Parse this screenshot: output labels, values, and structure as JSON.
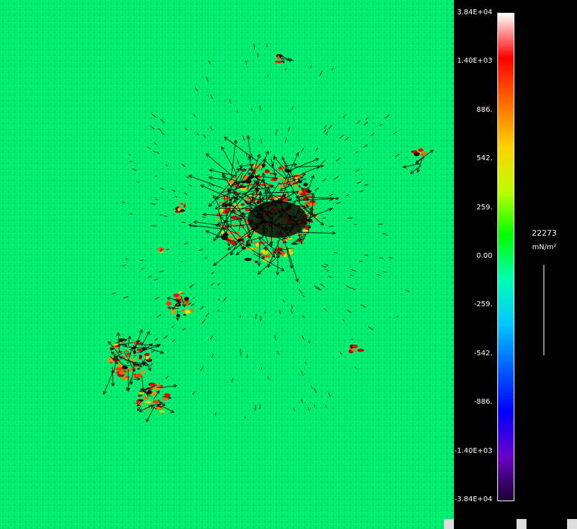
{
  "colorbar": {
    "ticks": [
      "3.84E+04",
      "1.40E+03",
      "886.",
      "542.",
      "259.",
      "0.00",
      "-259.",
      "-542.",
      "-886.",
      "-1.40E+03",
      "-3.84E+04"
    ],
    "stops": [
      "#ffffff",
      "#ff0000",
      "#ff6a00",
      "#ffd000",
      "#bfff00",
      "#00ff00",
      "#00ffb0",
      "#00c8ff",
      "#0060ff",
      "#0000ff",
      "#6a00c8",
      "#1a0030"
    ]
  },
  "scale": {
    "value": "22273",
    "unit": "mN/m^2",
    "unit_display": "mN/m²"
  },
  "field": {
    "background": "#00ee70",
    "dot_color": "#114433"
  }
}
